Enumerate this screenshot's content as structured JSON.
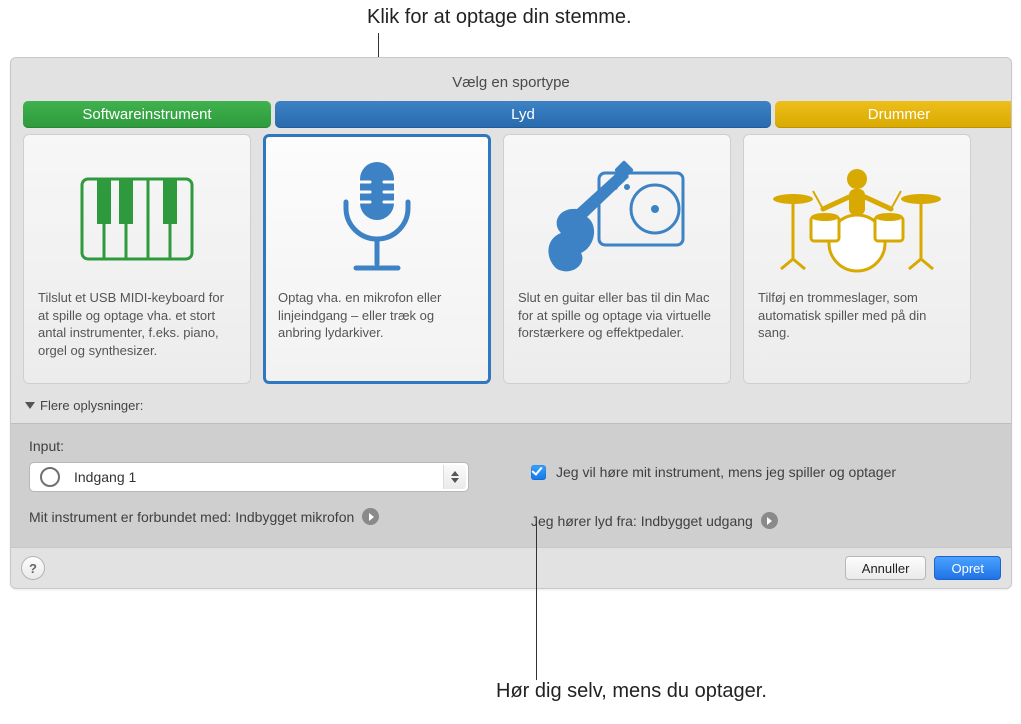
{
  "callouts": {
    "top": "Klik for at optage din stemme.",
    "bottom": "Hør dig selv, mens du optager."
  },
  "dialog": {
    "title": "Vælg en sportype",
    "tabs": {
      "software": "Softwareinstrument",
      "audio": "Lyd",
      "drummer": "Drummer"
    },
    "cards": {
      "software_desc": "Tilslut et USB MIDI-keyboard for at spille og optage vha. et stort antal instrumenter, f.eks. piano, orgel og synthesizer.",
      "audio_mic_desc": "Optag vha. en mikrofon eller linjeindgang – eller træk og anbring lydarkiver.",
      "audio_guitar_desc": "Slut en guitar eller bas til din Mac for at spille og optage via virtuelle forstærkere og effektpedaler.",
      "drummer_desc": "Tilføj en trommeslager, som automatisk spiller med på din sang."
    },
    "disclosure_label": "Flere oplysninger:",
    "details": {
      "input_label": "Input:",
      "input_value": "Indgang 1",
      "monitoring_label": "Jeg vil høre mit instrument, mens jeg spiller og optager",
      "instrument_connected": "Mit instrument er forbundet med: Indbygget mikrofon",
      "output_from": "Jeg hører lyd fra: Indbygget udgang"
    },
    "footer": {
      "help": "?",
      "cancel": "Annuller",
      "create": "Opret"
    }
  }
}
